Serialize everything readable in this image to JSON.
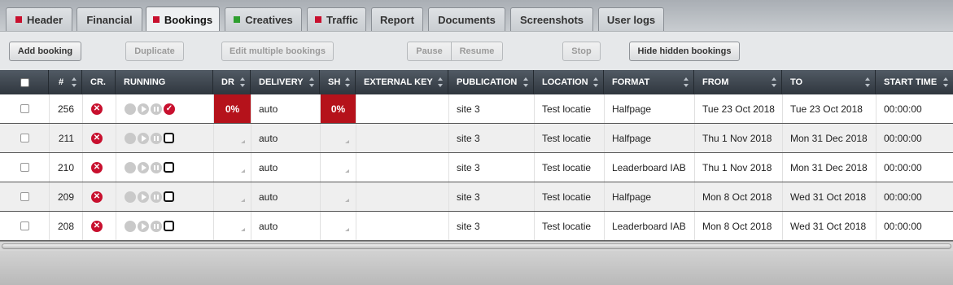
{
  "tabs": [
    {
      "label": "Header",
      "marker": "#c8102e"
    },
    {
      "label": "Financial",
      "marker": ""
    },
    {
      "label": "Bookings",
      "marker": "#c8102e",
      "active": true
    },
    {
      "label": "Creatives",
      "marker": "#2e9e2e"
    },
    {
      "label": "Traffic",
      "marker": "#c8102e"
    },
    {
      "label": "Report",
      "marker": ""
    },
    {
      "label": "Documents",
      "marker": ""
    },
    {
      "label": "Screenshots",
      "marker": ""
    },
    {
      "label": "User logs",
      "marker": ""
    }
  ],
  "toolbar": {
    "add_booking": "Add booking",
    "duplicate": "Duplicate",
    "edit_multiple": "Edit multiple bookings",
    "pause": "Pause",
    "resume": "Resume",
    "stop": "Stop",
    "hide_hidden": "Hide hidden bookings"
  },
  "columns": {
    "num": "#",
    "cr": "CR.",
    "running": "RUNNING",
    "dr": "DR",
    "delivery": "DELIVERY",
    "sh": "SH",
    "external_key": "EXTERNAL KEY",
    "publication": "PUBLICATION",
    "location": "LOCATION",
    "format": "FORMAT",
    "from": "FROM",
    "to": "TO",
    "start_time": "START TIME"
  },
  "rows": [
    {
      "id": "256",
      "dr": "0%",
      "delivery": "auto",
      "sh": "0%",
      "external_key": "",
      "publication": "site 3",
      "location": "Test locatie",
      "format": "Halfpage",
      "from": "Tue 23 Oct 2018",
      "to": "Tue 23 Oct 2018",
      "start_time": "00:00:00",
      "status": "active"
    },
    {
      "id": "211",
      "dr": "",
      "delivery": "auto",
      "sh": "",
      "external_key": "",
      "publication": "site 3",
      "location": "Test locatie",
      "format": "Halfpage",
      "from": "Thu 1 Nov 2018",
      "to": "Mon 31 Dec 2018",
      "start_time": "00:00:00",
      "status": "stopped"
    },
    {
      "id": "210",
      "dr": "",
      "delivery": "auto",
      "sh": "",
      "external_key": "",
      "publication": "site 3",
      "location": "Test locatie",
      "format": "Leaderboard IAB",
      "from": "Thu 1 Nov 2018",
      "to": "Mon 31 Dec 2018",
      "start_time": "00:00:00",
      "status": "stopped"
    },
    {
      "id": "209",
      "dr": "",
      "delivery": "auto",
      "sh": "",
      "external_key": "",
      "publication": "site 3",
      "location": "Test locatie",
      "format": "Halfpage",
      "from": "Mon 8 Oct 2018",
      "to": "Wed 31 Oct 2018",
      "start_time": "00:00:00",
      "status": "stopped"
    },
    {
      "id": "208",
      "dr": "",
      "delivery": "auto",
      "sh": "",
      "external_key": "",
      "publication": "site 3",
      "location": "Test locatie",
      "format": "Leaderboard IAB",
      "from": "Mon 8 Oct 2018",
      "to": "Wed 31 Oct 2018",
      "start_time": "00:00:00",
      "status": "stopped"
    }
  ]
}
